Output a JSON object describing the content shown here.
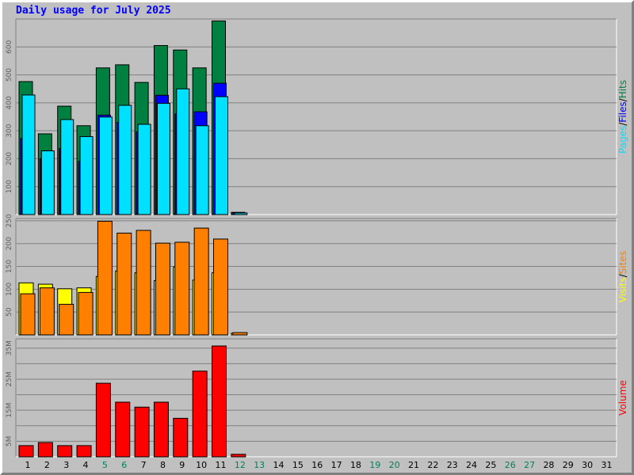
{
  "title": "Daily usage for July 2025",
  "colors": {
    "hits": "#008040",
    "files": "#0000ff",
    "pages": "#00e0ff",
    "visits": "#ffff00",
    "sites": "#ff8000",
    "volume": "#ff0000",
    "weekend_day": "#00805c",
    "weekday_day": "#000000"
  },
  "chart_data": [
    {
      "type": "bar",
      "panel": "pages-files-hits",
      "side_label": [
        "Pages",
        "Files",
        "Hits"
      ],
      "categories": [
        "1",
        "2",
        "3",
        "4",
        "5",
        "6",
        "7",
        "8",
        "9",
        "10",
        "11",
        "12",
        "13",
        "14",
        "15",
        "16",
        "17",
        "18",
        "19",
        "20",
        "21",
        "22",
        "23",
        "24",
        "25",
        "26",
        "27",
        "28",
        "29",
        "30",
        "31"
      ],
      "weekend_days": [
        "5",
        "6",
        "12",
        "13",
        "19",
        "20",
        "26",
        "27"
      ],
      "series": [
        {
          "name": "Hits",
          "values": [
            476,
            289,
            388,
            318,
            525,
            536,
            473,
            605,
            589,
            525,
            693,
            8,
            0,
            0,
            0,
            0,
            0,
            0,
            0,
            0,
            0,
            0,
            0,
            0,
            0,
            0,
            0,
            0,
            0,
            0,
            0
          ]
        },
        {
          "name": "Files",
          "values": [
            272,
            200,
            236,
            190,
            356,
            330,
            296,
            427,
            360,
            368,
            470,
            5,
            0,
            0,
            0,
            0,
            0,
            0,
            0,
            0,
            0,
            0,
            0,
            0,
            0,
            0,
            0,
            0,
            0,
            0,
            0
          ]
        },
        {
          "name": "Pages",
          "values": [
            428,
            228,
            340,
            279,
            349,
            391,
            323,
            398,
            450,
            318,
            422,
            4,
            0,
            0,
            0,
            0,
            0,
            0,
            0,
            0,
            0,
            0,
            0,
            0,
            0,
            0,
            0,
            0,
            0,
            0,
            0
          ]
        }
      ],
      "ylim": [
        0,
        700
      ],
      "yticks": [
        100,
        200,
        300,
        400,
        500,
        600
      ],
      "ytick_labels": [
        "100",
        "200",
        "300",
        "400",
        "500",
        "600"
      ]
    },
    {
      "type": "bar",
      "panel": "visits-sites",
      "side_label": [
        "Visits",
        "Sites"
      ],
      "categories": [
        "1",
        "2",
        "3",
        "4",
        "5",
        "6",
        "7",
        "8",
        "9",
        "10",
        "11",
        "12",
        "13",
        "14",
        "15",
        "16",
        "17",
        "18",
        "19",
        "20",
        "21",
        "22",
        "23",
        "24",
        "25",
        "26",
        "27",
        "28",
        "29",
        "30",
        "31"
      ],
      "series": [
        {
          "name": "Visits",
          "values": [
            114,
            111,
            101,
            103,
            128,
            140,
            136,
            119,
            149,
            120,
            136,
            2,
            0,
            0,
            0,
            0,
            0,
            0,
            0,
            0,
            0,
            0,
            0,
            0,
            0,
            0,
            0,
            0,
            0,
            0,
            0
          ]
        },
        {
          "name": "Sites",
          "values": [
            90,
            103,
            67,
            93,
            249,
            223,
            229,
            201,
            203,
            234,
            210,
            5,
            0,
            0,
            0,
            0,
            0,
            0,
            0,
            0,
            0,
            0,
            0,
            0,
            0,
            0,
            0,
            0,
            0,
            0,
            0
          ]
        }
      ],
      "ylim": [
        0,
        255
      ],
      "yticks": [
        50,
        100,
        150,
        200,
        250
      ],
      "ytick_labels": [
        "50",
        "100",
        "150",
        "200",
        "250"
      ]
    },
    {
      "type": "bar",
      "panel": "volume",
      "side_label": [
        "Volume"
      ],
      "categories": [
        "1",
        "2",
        "3",
        "4",
        "5",
        "6",
        "7",
        "8",
        "9",
        "10",
        "11",
        "12",
        "13",
        "14",
        "15",
        "16",
        "17",
        "18",
        "19",
        "20",
        "21",
        "22",
        "23",
        "24",
        "25",
        "26",
        "27",
        "28",
        "29",
        "30",
        "31"
      ],
      "series": [
        {
          "name": "Volume",
          "values": [
            3.6,
            4.6,
            3.6,
            3.6,
            23.7,
            17.6,
            16.0,
            17.6,
            12.4,
            27.6,
            35.7,
            0.8,
            0,
            0,
            0,
            0,
            0,
            0,
            0,
            0,
            0,
            0,
            0,
            0,
            0,
            0,
            0,
            0,
            0,
            0,
            0
          ]
        }
      ],
      "ylim": [
        0,
        38
      ],
      "yticks": [
        5,
        10,
        15,
        20,
        25,
        30,
        35
      ],
      "ytick_labels": [
        "5M",
        "",
        "15M",
        "",
        "25M",
        "",
        "35M"
      ]
    }
  ]
}
